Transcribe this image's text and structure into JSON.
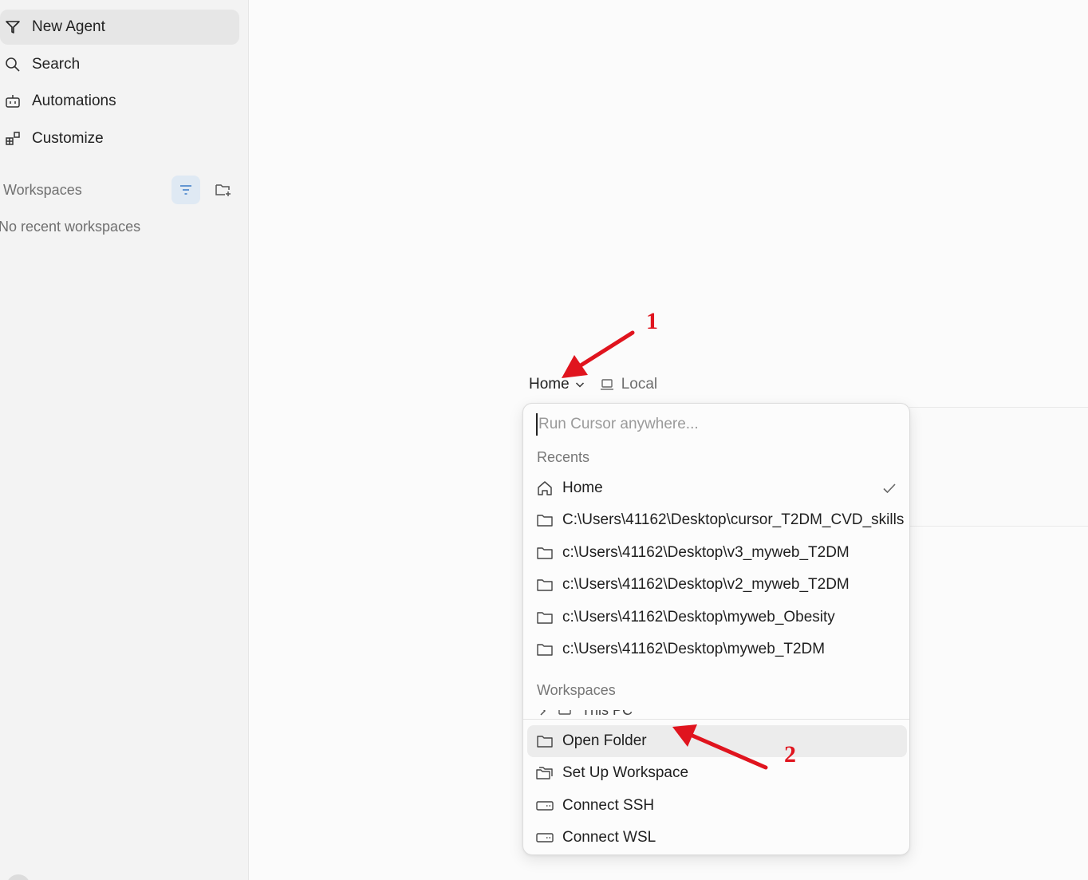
{
  "sidebar": {
    "nav": [
      {
        "label": "New Agent",
        "icon": "new-agent-icon"
      },
      {
        "label": "Search",
        "icon": "search-icon"
      },
      {
        "label": "Automations",
        "icon": "automations-icon"
      },
      {
        "label": "Customize",
        "icon": "customize-icon"
      }
    ],
    "workspaces_label": "Workspaces",
    "empty_text": "No recent workspaces"
  },
  "location": {
    "current": "Home",
    "mode": "Local"
  },
  "dropdown": {
    "search_placeholder": "Run Cursor anywhere...",
    "recents_label": "Recents",
    "recents": [
      {
        "label": "Home",
        "icon": "home-icon",
        "selected": true
      },
      {
        "label": "C:\\Users\\41162\\Desktop\\cursor_T2DM_CVD_skills",
        "icon": "folder-icon"
      },
      {
        "label": "c:\\Users\\41162\\Desktop\\v3_myweb_T2DM",
        "icon": "folder-icon"
      },
      {
        "label": "c:\\Users\\41162\\Desktop\\v2_myweb_T2DM",
        "icon": "folder-icon"
      },
      {
        "label": "c:\\Users\\41162\\Desktop\\myweb_Obesity",
        "icon": "folder-icon"
      },
      {
        "label": "c:\\Users\\41162\\Desktop\\myweb_T2DM",
        "icon": "folder-icon"
      }
    ],
    "workspaces_label": "Workspaces",
    "workspace_peek": "This PC",
    "actions": [
      {
        "label": "Open Folder",
        "icon": "folder-icon",
        "highlighted": true
      },
      {
        "label": "Set Up Workspace",
        "icon": "setup-workspace-icon"
      },
      {
        "label": "Connect SSH",
        "icon": "ssh-icon"
      },
      {
        "label": "Connect WSL",
        "icon": "wsl-icon"
      }
    ]
  },
  "annotations": {
    "label_1": "1",
    "label_2": "2",
    "color": "#e0141e"
  }
}
